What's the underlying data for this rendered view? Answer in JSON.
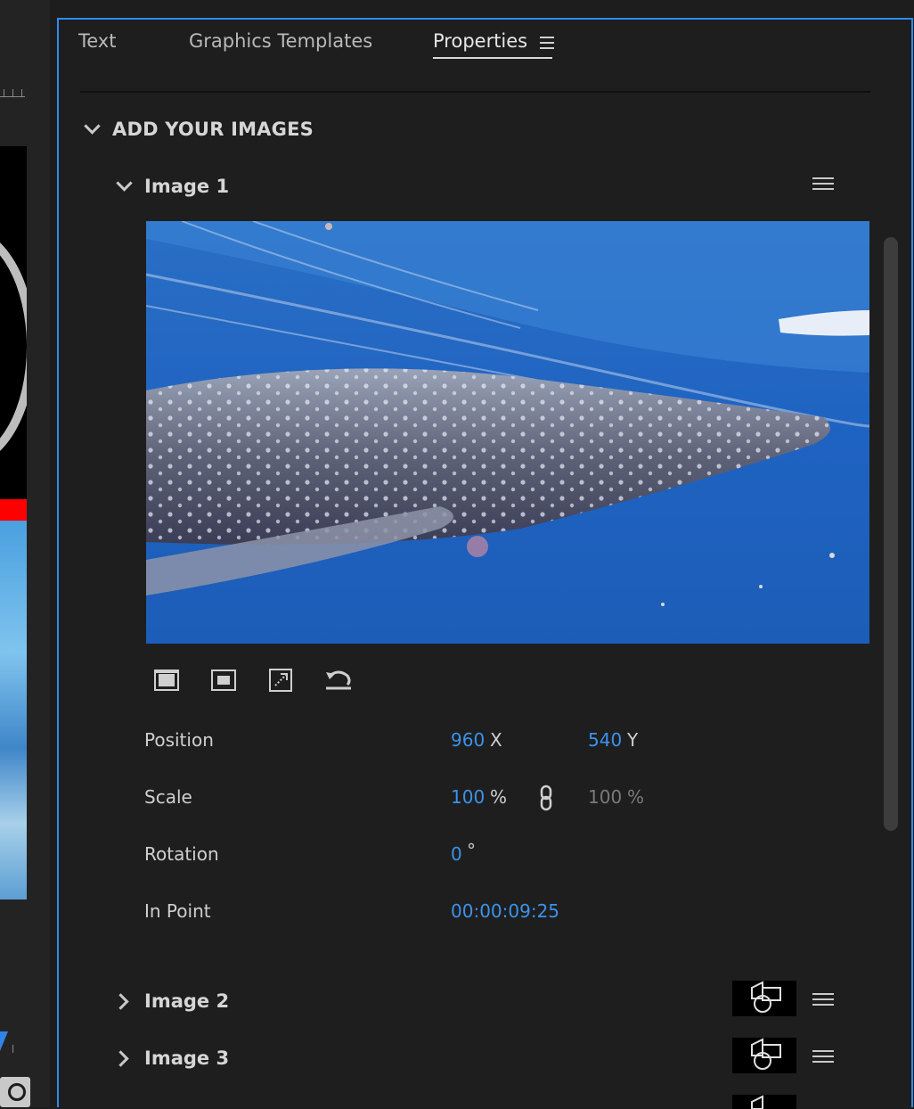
{
  "tabs": [
    {
      "label": "Text"
    },
    {
      "label": "Graphics Templates"
    },
    {
      "label": "Properties"
    }
  ],
  "section": {
    "title": "ADD YOUR IMAGES"
  },
  "image1": {
    "title": "Image 1",
    "properties": {
      "position_label": "Position",
      "position_x": "960",
      "position_x_unit": "X",
      "position_y": "540",
      "position_y_unit": "Y",
      "scale_label": "Scale",
      "scale_w": "100",
      "scale_w_unit": "%",
      "scale_h": "100",
      "scale_h_unit": "%",
      "rotation_label": "Rotation",
      "rotation": "0",
      "rotation_unit": "°",
      "in_point_label": "In Point",
      "in_point": "00:00:09:25"
    }
  },
  "image2": {
    "title": "Image 2"
  },
  "image3": {
    "title": "Image 3"
  },
  "colors": {
    "accent": "#2d8ceb",
    "value": "#3b93ea",
    "background": "#1e1e1e"
  },
  "icons": [
    "hamburger-menu-icon",
    "chevron-down-icon",
    "chevron-right-icon",
    "fit-frame-icon",
    "fill-frame-icon",
    "scale-to-frame-icon",
    "reset-icon",
    "link-icon",
    "placeholder-shapes-icon"
  ]
}
